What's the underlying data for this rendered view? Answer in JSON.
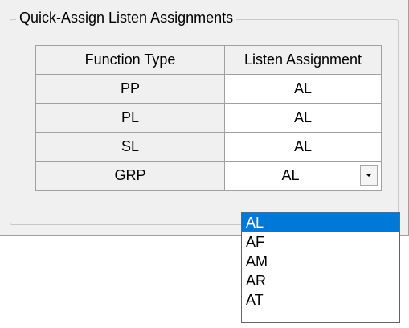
{
  "group": {
    "title": "Quick-Assign Listen Assignments"
  },
  "table": {
    "headers": [
      "Function Type",
      "Listen Assignment"
    ],
    "rows": [
      {
        "function_type": "PP",
        "listen_assignment": "AL"
      },
      {
        "function_type": "PL",
        "listen_assignment": "AL"
      },
      {
        "function_type": "SL",
        "listen_assignment": "AL"
      },
      {
        "function_type": "GRP",
        "listen_assignment": "AL"
      }
    ]
  },
  "dropdown": {
    "icon": "chevron-down-icon",
    "options": [
      "AL",
      "AF",
      "AM",
      "AR",
      "AT"
    ],
    "selected": "AL",
    "highlight_color": "#0078d7"
  }
}
